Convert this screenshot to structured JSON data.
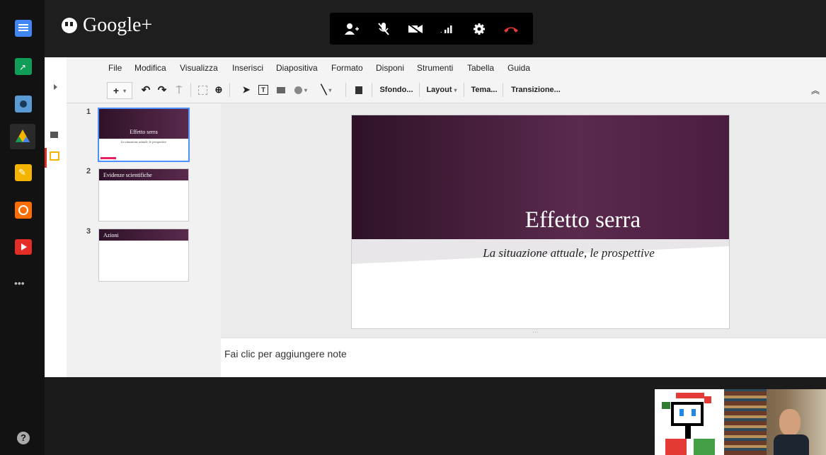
{
  "app_title": "Google+",
  "sidebar": {
    "apps": [
      {
        "name": "docs-icon",
        "color": "#4285f4"
      },
      {
        "name": "slides-icon",
        "color": "#0f9d58"
      },
      {
        "name": "camera-icon",
        "color": "#5b9bd5"
      },
      {
        "name": "drive-icon",
        "color": "#f4b400"
      },
      {
        "name": "pencil-app-icon",
        "color": "#f4b400"
      },
      {
        "name": "radio-icon",
        "color": "#ff6d00"
      },
      {
        "name": "youtube-icon",
        "color": "#e52d27"
      }
    ],
    "more_label": "•••",
    "help_label": "?"
  },
  "menu": {
    "items": [
      "File",
      "Modifica",
      "Visualizza",
      "Inserisci",
      "Diapositiva",
      "Formato",
      "Disponi",
      "Strumenti",
      "Tabella",
      "Guida"
    ]
  },
  "toolbar": {
    "add_label": "+",
    "sfondo": "Sfondo...",
    "layout": "Layout",
    "tema": "Tema...",
    "transizione": "Transizione..."
  },
  "slides": [
    {
      "number": "1",
      "title": "Effetto serra",
      "subtitle": "La situazione attuale, le prospettive"
    },
    {
      "number": "2",
      "title": "Evidenze scientifiche"
    },
    {
      "number": "3",
      "title": "Azioni"
    }
  ],
  "current_slide": {
    "title": "Effetto serra",
    "subtitle": "La situazione attuale, le prospettive"
  },
  "notes_placeholder": "Fai clic per aggiungere note",
  "colors": {
    "accent": "#4a1d3f",
    "hangup": "#e53935",
    "selection": "#4d90fe"
  }
}
